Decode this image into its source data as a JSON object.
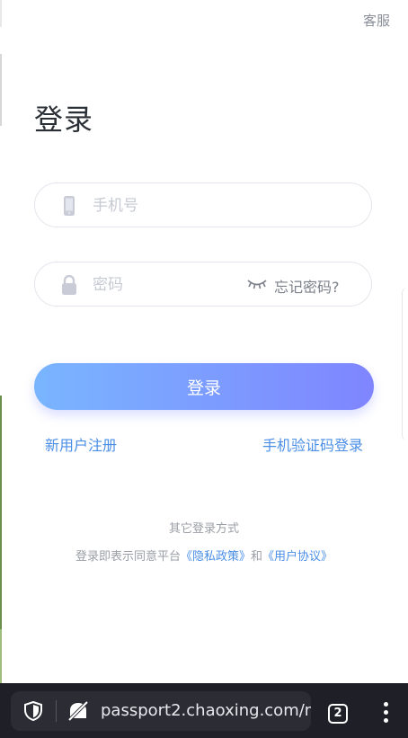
{
  "header": {
    "service_label": "客服",
    "title": "登录"
  },
  "form": {
    "phone_placeholder": "手机号",
    "password_placeholder": "密码",
    "forgot_label": "忘记密码?",
    "login_label": "登录"
  },
  "links": {
    "register": "新用户注册",
    "sms_login": "手机验证码登录"
  },
  "footer": {
    "other_methods": "其它登录方式",
    "agree_prefix": "登录即表示同意平台",
    "privacy": "《隐私政策》",
    "and": "和",
    "user_agreement": "《用户协议》"
  },
  "browser": {
    "url": "passport2.chaoxing.com/m",
    "tab_count": "2"
  },
  "icons": {
    "phone": "phone-icon",
    "lock": "lock-icon",
    "eye": "eye-closed-icon",
    "shield": "shield-icon",
    "no_tracking": "no-tracking-icon",
    "menu": "more-vertical-icon"
  },
  "colors": {
    "accent": "#4a8ee6",
    "button_start": "#79b5ff",
    "button_end": "#7f85ff",
    "browser_bar": "#1f1f27"
  }
}
